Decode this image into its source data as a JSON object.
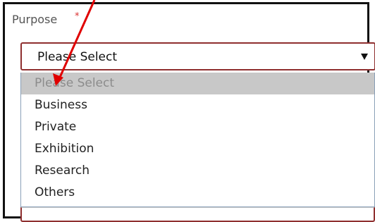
{
  "field": {
    "label": "Purpose",
    "required_marker": "*",
    "selected_value": "Please Select"
  },
  "dropdown": {
    "options": [
      "Please Select",
      "Business",
      "Private",
      "Exhibition",
      "Research",
      "Others"
    ],
    "highlighted_index": 0
  },
  "colors": {
    "field_border": "#8f2f2f",
    "highlight_bg": "#c8c8c8",
    "annotation_arrow": "#e00000"
  }
}
